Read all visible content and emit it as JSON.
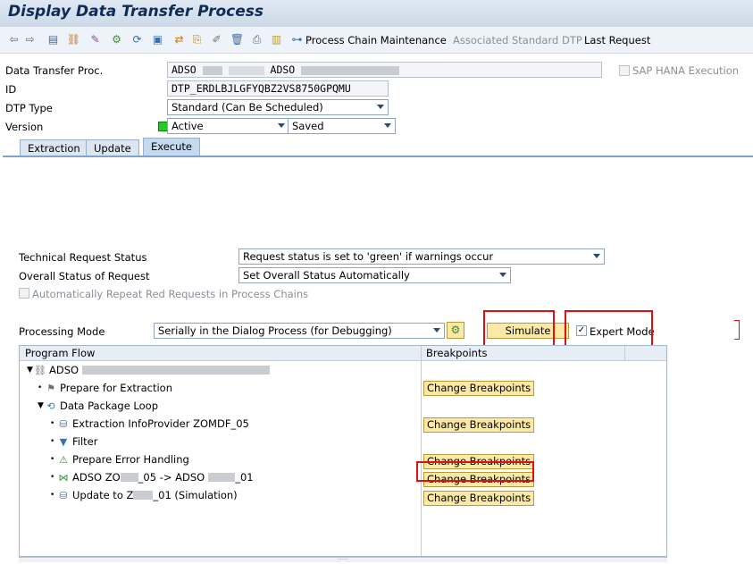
{
  "window": {
    "title": "Display Data Transfer Process"
  },
  "toolbar": {
    "icons": [
      "back-icon",
      "forward-icon",
      "display-change-icon",
      "hierarchy-icon",
      "tool-icon",
      "settings-icon",
      "refresh-icon",
      "monitor-icon",
      "transfer-icon",
      "paste-icon",
      "edit-icon",
      "delete-icon",
      "print-icon",
      "clipboard-icon"
    ],
    "process_chain": "Process Chain Maintenance",
    "associated_dtp": "Associated Standard DTP",
    "last_request": "Last Request"
  },
  "header": {
    "dtp_label": "Data Transfer Proc.",
    "dtp_value_1": "ADSO",
    "dtp_value_2": "ADSO",
    "sap_hana_label": "SAP HANA Execution",
    "id_label": "ID",
    "id_value": "DTP_ERDLBJLGFYQBZ2VS8750GPQMU",
    "dtp_type_label": "DTP Type",
    "dtp_type_value": "Standard (Can Be Scheduled)",
    "version_label": "Version",
    "version_value": "Active",
    "saved_value": "Saved",
    "status_color": "#22cc22"
  },
  "tabs": [
    {
      "label": "Extraction"
    },
    {
      "label": "Update"
    },
    {
      "label": "Execute"
    }
  ],
  "execute": {
    "tech_status_label": "Technical Request Status",
    "tech_status_value": "Request status is set to 'green' if warnings occur",
    "overall_status_label": "Overall Status of Request",
    "overall_status_value": "Set Overall Status Automatically",
    "auto_repeat_label": "Automatically Repeat Red Requests in Process Chains",
    "processing_mode_label": "Processing Mode",
    "processing_mode_value": "Serially in the Dialog Process (for Debugging)",
    "simulate_label": "Simulate",
    "expert_mode_label": "Expert Mode",
    "expert_mode_checked": true
  },
  "tree": {
    "col_program_flow": "Program Flow",
    "col_breakpoints": "Breakpoints",
    "rows": [
      {
        "label": "ADSO",
        "icon": "hierarchy-icon",
        "breakpoint": ""
      },
      {
        "label": "Prepare for Extraction",
        "icon": "flag-icon",
        "breakpoint": "Change Breakpoints"
      },
      {
        "label": "Data Package Loop",
        "icon": "loop-icon",
        "breakpoint": ""
      },
      {
        "label": "Extraction InfoProvider ZOMDF_05",
        "icon": "database-icon",
        "breakpoint": "Change Breakpoints"
      },
      {
        "label": "Filter",
        "icon": "filter-icon",
        "breakpoint": ""
      },
      {
        "label": "Prepare Error Handling",
        "icon": "error-handling-icon",
        "breakpoint": "Change Breakpoints"
      },
      {
        "label_a": "ADSO ZO",
        "label_b": "_05 -> ADSO",
        "label_c": "_01",
        "icon": "transformation-icon",
        "breakpoint": "Change Breakpoints"
      },
      {
        "label_a": "Update to Z",
        "label_c": "_01 (Simulation)",
        "icon": "database-icon",
        "breakpoint": "Change Breakpoints"
      }
    ]
  }
}
